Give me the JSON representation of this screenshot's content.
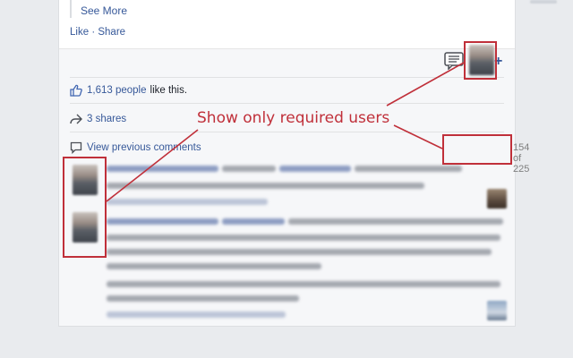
{
  "post": {
    "see_more": "See More",
    "like_label": "Like",
    "share_label": "Share",
    "separator": "·"
  },
  "stats": {
    "likes_count": "1,613 people",
    "likes_suffix": "like this.",
    "shares": "3 shares",
    "view_previous": "View previous comments",
    "pagination": "154 of 225"
  },
  "annotation": {
    "text": "Show only required users",
    "color": "#c0303a"
  },
  "colors": {
    "link": "#365899",
    "card_bg": "#f6f7f9",
    "page_bg": "#e9ebee"
  },
  "icons": [
    "thumbs-up-icon",
    "share-arrow-icon",
    "comment-bubble-icon",
    "comment-filter-icon",
    "add-icon"
  ]
}
